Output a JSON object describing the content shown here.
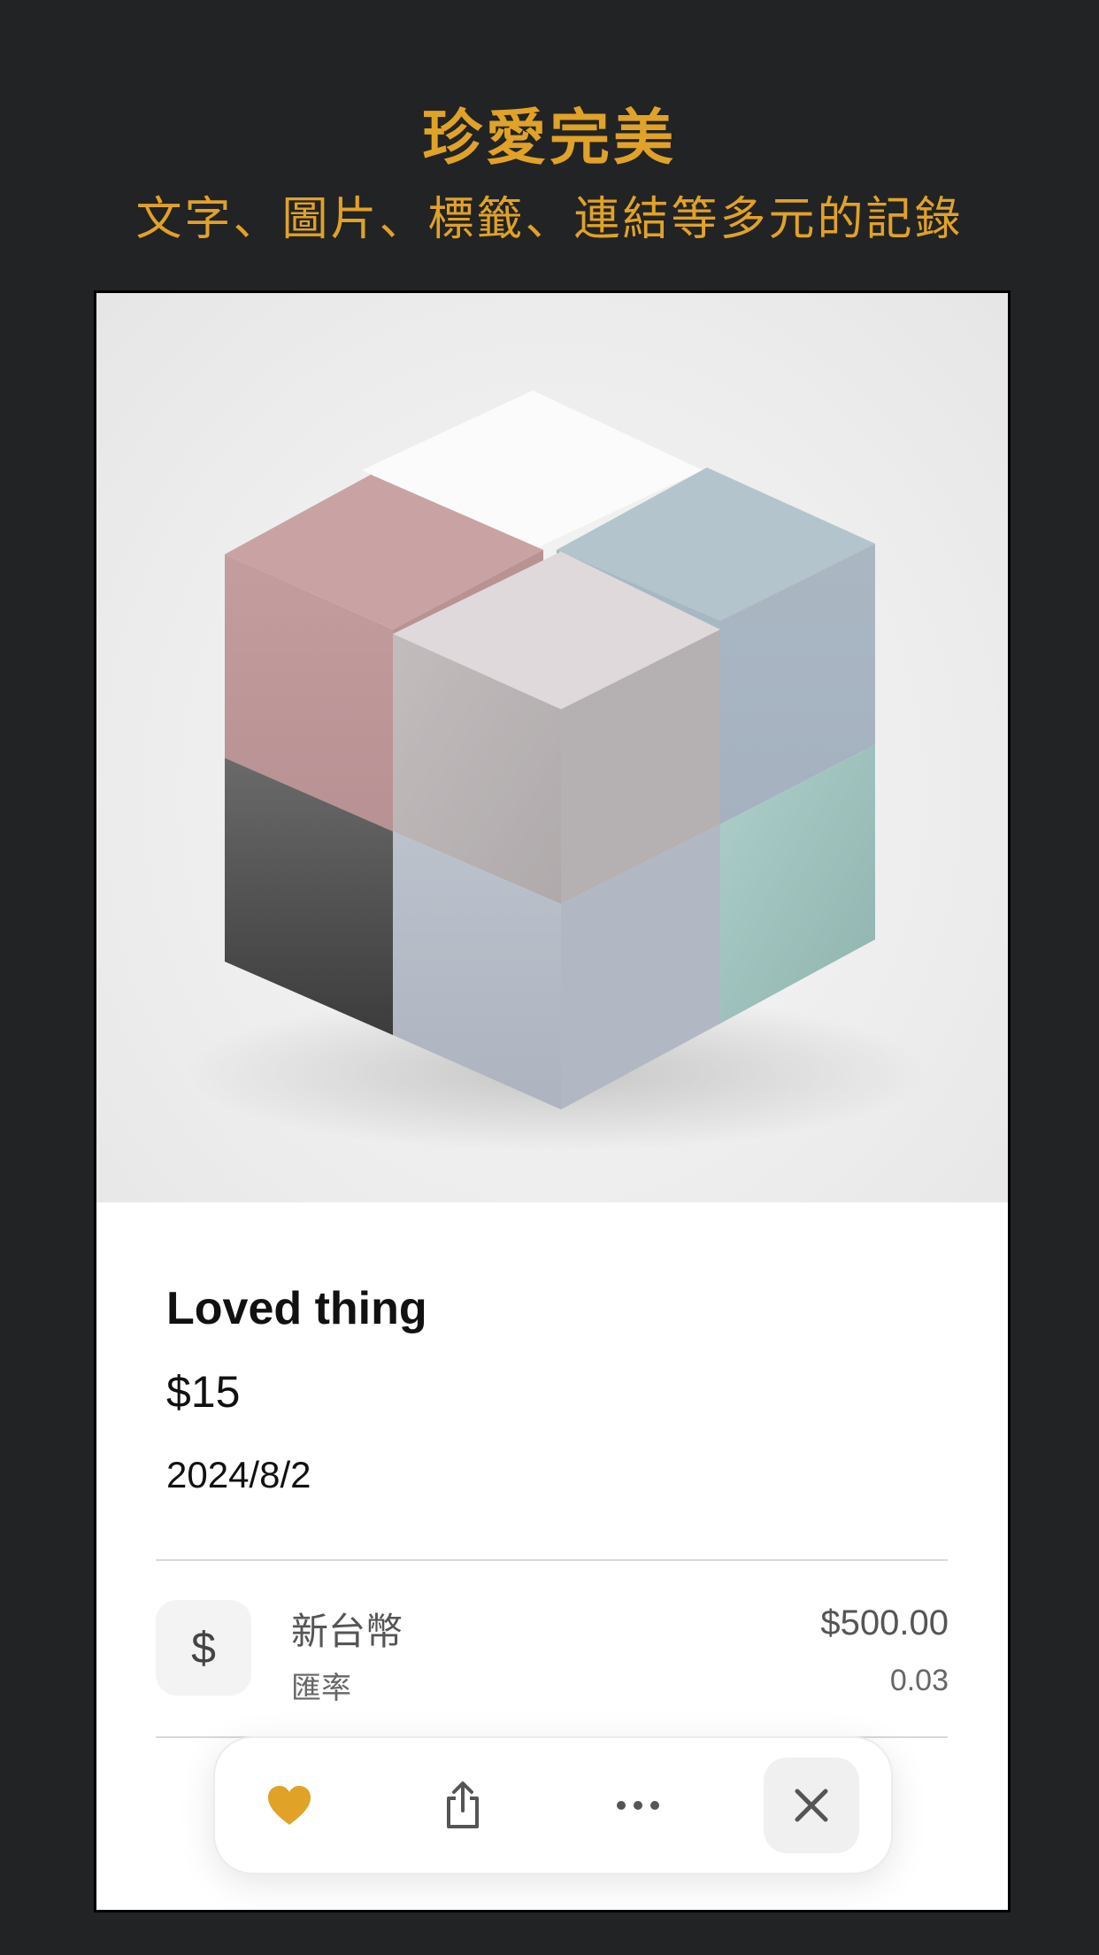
{
  "header": {
    "title": "珍愛完美",
    "subtitle": "文字、圖片、標籤、連結等多元的記錄"
  },
  "item": {
    "name": "Loved thing",
    "price": "$15",
    "date": "2024/8/2"
  },
  "currency": {
    "icon_symbol": "$",
    "name": "新台幣",
    "amount": "$500.00",
    "rate_label": "匯率",
    "rate_value": "0.03"
  },
  "toolbar": {
    "buttons": [
      {
        "name": "favorite",
        "icon": "heart-icon"
      },
      {
        "name": "share",
        "icon": "share-icon"
      },
      {
        "name": "more",
        "icon": "ellipsis-icon"
      },
      {
        "name": "close",
        "icon": "close-icon"
      }
    ]
  },
  "colors": {
    "accent": "#E0A227",
    "background": "#222325",
    "card": "#FFFFFF"
  }
}
